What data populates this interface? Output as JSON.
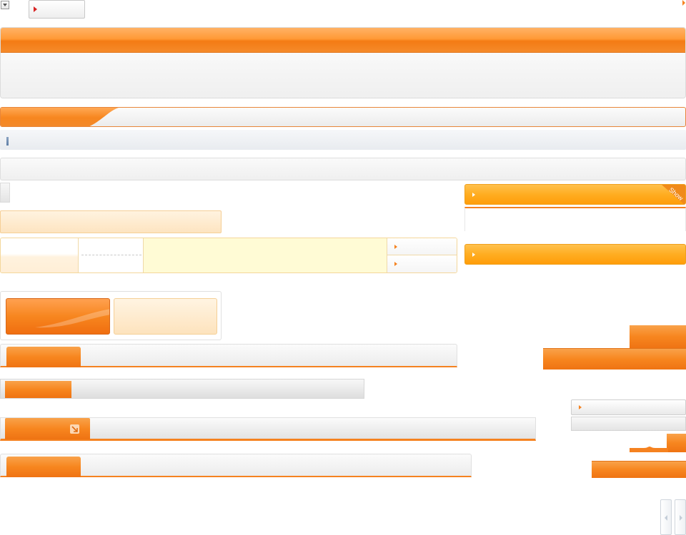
{
  "colors": {
    "accent": "#f58220",
    "accent_dark": "#e06a10",
    "accent_light": "#fde4c0",
    "panel_gray": "#f2f2f2",
    "note_yellow": "#fffbd5"
  },
  "icons": {
    "dropdown": "chevron-down-icon",
    "play": "play-arrow-icon",
    "corner": "triangle-right-icon",
    "expand": "expand-arrow-icon",
    "prev": "chevron-left-icon",
    "next": "chevron-right-icon"
  },
  "sidebar": {
    "panel_corner_label": "Show"
  }
}
